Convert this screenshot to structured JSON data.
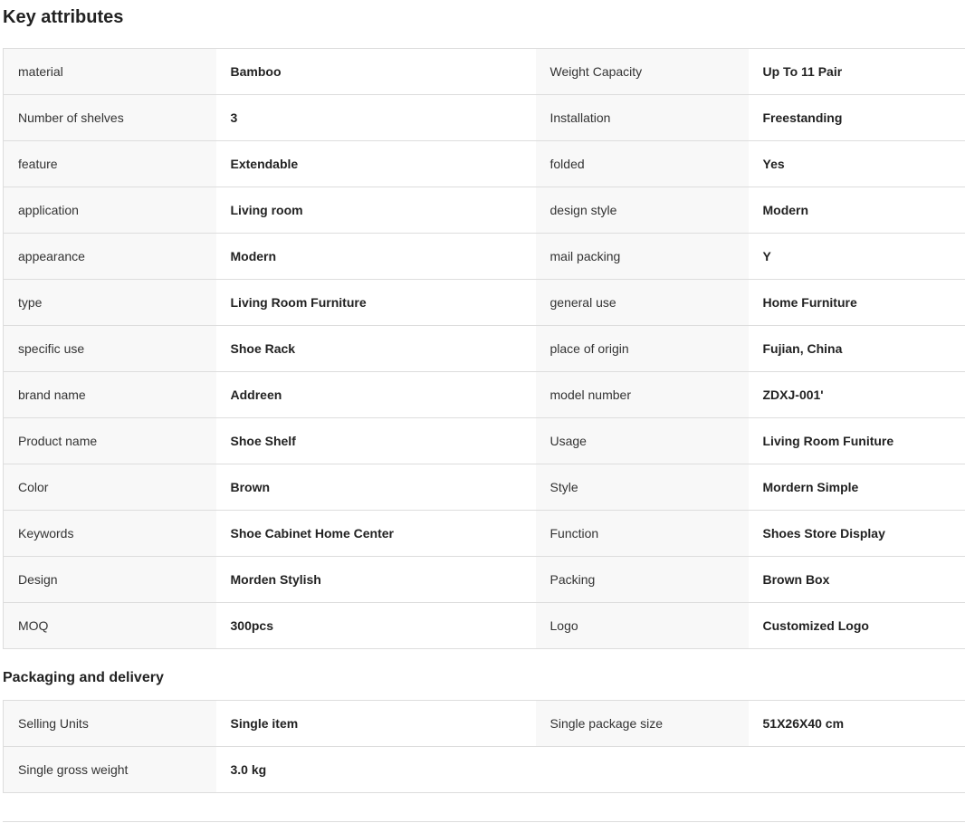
{
  "key_attributes": {
    "title": "Key attributes",
    "rows": [
      [
        {
          "label": "material",
          "value": "Bamboo"
        },
        {
          "label": "Weight Capacity",
          "value": "Up To 11 Pair"
        }
      ],
      [
        {
          "label": "Number of shelves",
          "value": "3"
        },
        {
          "label": "Installation",
          "value": "Freestanding"
        }
      ],
      [
        {
          "label": "feature",
          "value": "Extendable"
        },
        {
          "label": "folded",
          "value": "Yes"
        }
      ],
      [
        {
          "label": "application",
          "value": "Living room"
        },
        {
          "label": "design style",
          "value": "Modern"
        }
      ],
      [
        {
          "label": "appearance",
          "value": "Modern"
        },
        {
          "label": "mail packing",
          "value": "Y"
        }
      ],
      [
        {
          "label": "type",
          "value": "Living Room Furniture"
        },
        {
          "label": "general use",
          "value": "Home Furniture"
        }
      ],
      [
        {
          "label": "specific use",
          "value": "Shoe Rack"
        },
        {
          "label": "place of origin",
          "value": "Fujian, China"
        }
      ],
      [
        {
          "label": "brand name",
          "value": "Addreen"
        },
        {
          "label": "model number",
          "value": "ZDXJ-001'"
        }
      ],
      [
        {
          "label": "Product name",
          "value": "Shoe Shelf"
        },
        {
          "label": "Usage",
          "value": "Living Room Funiture"
        }
      ],
      [
        {
          "label": "Color",
          "value": "Brown"
        },
        {
          "label": "Style",
          "value": "Mordern Simple"
        }
      ],
      [
        {
          "label": "Keywords",
          "value": "Shoe Cabinet Home Center"
        },
        {
          "label": "Function",
          "value": "Shoes Store Display"
        }
      ],
      [
        {
          "label": "Design",
          "value": "Morden Stylish"
        },
        {
          "label": "Packing",
          "value": "Brown Box"
        }
      ],
      [
        {
          "label": "MOQ",
          "value": "300pcs"
        },
        {
          "label": "Logo",
          "value": "Customized Logo"
        }
      ]
    ]
  },
  "packaging": {
    "title": "Packaging and delivery",
    "rows": [
      [
        {
          "label": "Selling Units",
          "value": "Single item"
        },
        {
          "label": "Single package size",
          "value": "51X26X40 cm"
        }
      ],
      [
        {
          "label": "Single gross weight",
          "value": "3.0 kg"
        }
      ]
    ]
  }
}
